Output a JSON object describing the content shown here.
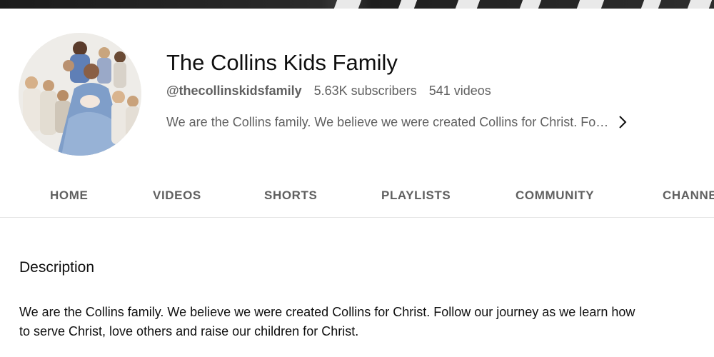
{
  "channel": {
    "name": "The Collins Kids Family",
    "handle": "@thecollinskidsfamily",
    "subscribers": "5.63K subscribers",
    "videos": "541 videos",
    "tagline": "We are the Collins family. We believe we were created Collins for Christ. Fo…"
  },
  "tabs": [
    {
      "label": "HOME"
    },
    {
      "label": "VIDEOS"
    },
    {
      "label": "SHORTS"
    },
    {
      "label": "PLAYLISTS"
    },
    {
      "label": "COMMUNITY"
    },
    {
      "label": "CHANNELS"
    }
  ],
  "about": {
    "heading": "Description",
    "text": "We are the Collins family. We believe we were created Collins for Christ. Follow our journey as we learn how to serve Christ, love others and raise our children for Christ."
  },
  "icons": {
    "tagline_more": "chevron-right-icon"
  },
  "colors": {
    "text_primary": "#0f0f0f",
    "text_secondary": "#606060",
    "divider": "#e5e5e5"
  }
}
